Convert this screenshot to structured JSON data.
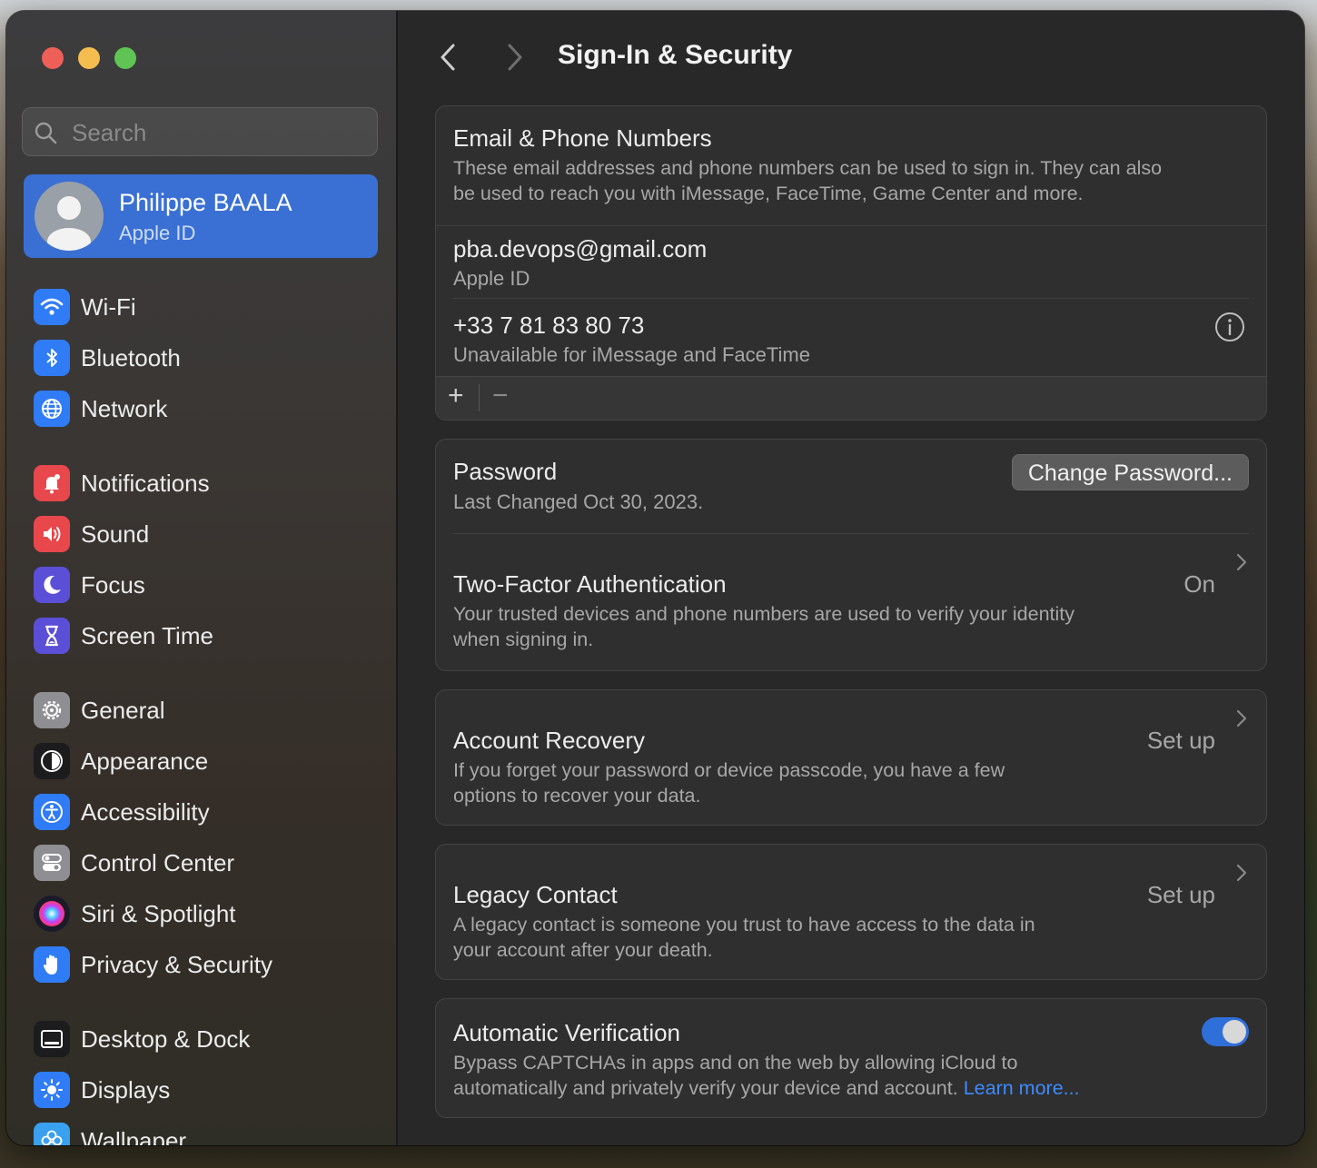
{
  "window": {
    "title": "Sign-In & Security",
    "search": {
      "placeholder": "Search"
    }
  },
  "profile": {
    "name": "Philippe BAALA",
    "subtitle": "Apple ID"
  },
  "sidebar": {
    "items": [
      {
        "label": "Wi-Fi",
        "icon": "wifi-icon",
        "color": "#2f7cf6"
      },
      {
        "label": "Bluetooth",
        "icon": "bluetooth-icon",
        "color": "#2f7cf6"
      },
      {
        "label": "Network",
        "icon": "globe-icon",
        "color": "#2f7cf6"
      },
      {
        "label": "Notifications",
        "icon": "bell-icon",
        "color": "#e8474c"
      },
      {
        "label": "Sound",
        "icon": "speaker-icon",
        "color": "#e8474c"
      },
      {
        "label": "Focus",
        "icon": "moon-icon",
        "color": "#5a4fd6"
      },
      {
        "label": "Screen Time",
        "icon": "hourglass-icon",
        "color": "#5a4fd6"
      },
      {
        "label": "General",
        "icon": "gear-icon",
        "color": "#8e8e93"
      },
      {
        "label": "Appearance",
        "icon": "appearance-icon",
        "color": "#1c1c1e"
      },
      {
        "label": "Accessibility",
        "icon": "accessibility-icon",
        "color": "#2f7cf6"
      },
      {
        "label": "Control Center",
        "icon": "toggles-icon",
        "color": "#8e8e93"
      },
      {
        "label": "Siri & Spotlight",
        "icon": "siri-icon",
        "color": "#3a2b6b"
      },
      {
        "label": "Privacy & Security",
        "icon": "hand-icon",
        "color": "#2f7cf6"
      },
      {
        "label": "Desktop & Dock",
        "icon": "dock-icon",
        "color": "#1c1c1e"
      },
      {
        "label": "Displays",
        "icon": "sun-icon",
        "color": "#2f7cf6"
      },
      {
        "label": "Wallpaper",
        "icon": "flower-icon",
        "color": "#3aa0f0"
      }
    ]
  },
  "email_section": {
    "heading": "Email & Phone Numbers",
    "description_line1": "These email addresses and phone numbers can be used to sign in. They can also",
    "description_line2": "be used to reach you with iMessage, FaceTime, Game Center and more.",
    "entries": [
      {
        "value": "pba.devops@gmail.com",
        "detail": "Apple ID"
      },
      {
        "value": "+33 7 81 83 80 73",
        "detail": "Unavailable for iMessage and FaceTime"
      }
    ],
    "add_label": "+",
    "remove_label": "−"
  },
  "password": {
    "heading": "Password",
    "detail": "Last Changed Oct 30, 2023.",
    "button": "Change Password..."
  },
  "two_factor": {
    "heading": "Two-Factor Authentication",
    "value": "On",
    "description_line1": "Your trusted devices and phone numbers are used to verify your identity",
    "description_line2": "when signing in."
  },
  "account_recovery": {
    "heading": "Account Recovery",
    "value": "Set up",
    "description_line1": "If you forget your password or device passcode, you have a few",
    "description_line2": "options to recover your data."
  },
  "legacy_contact": {
    "heading": "Legacy Contact",
    "value": "Set up",
    "description_line1": "A legacy contact is someone you trust to have access to the data in",
    "description_line2": "your account after your death."
  },
  "automatic_verification": {
    "heading": "Automatic Verification",
    "enabled": true,
    "description_line1": "Bypass CAPTCHAs in apps and on the web by allowing iCloud to",
    "description_line2": "automatically and privately verify your device and account.",
    "link": "Learn more..."
  }
}
